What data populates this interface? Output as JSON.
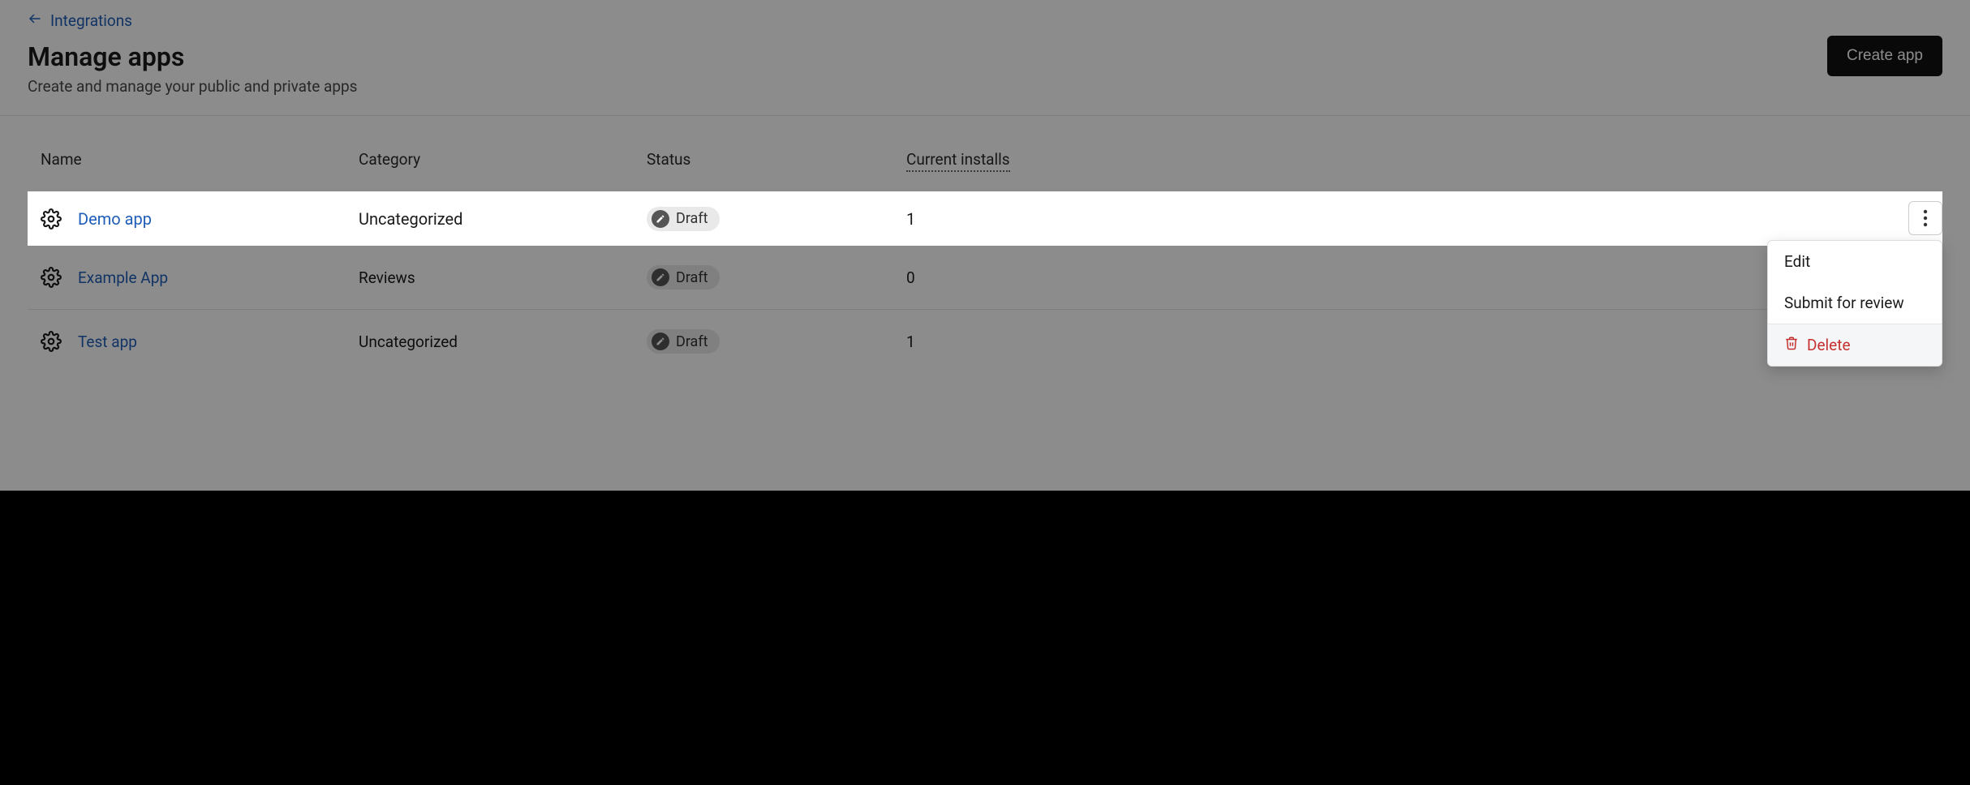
{
  "breadcrumb": {
    "label": "Integrations"
  },
  "header": {
    "title": "Manage apps",
    "subtitle": "Create and manage your public and private apps",
    "create_label": "Create app"
  },
  "table": {
    "columns": {
      "name": "Name",
      "category": "Category",
      "status": "Status",
      "installs": "Current installs"
    },
    "rows": [
      {
        "name": "Demo app",
        "category": "Uncategorized",
        "status": "Draft",
        "installs": "1"
      },
      {
        "name": "Example App",
        "category": "Reviews",
        "status": "Draft",
        "installs": "0"
      },
      {
        "name": "Test app",
        "category": "Uncategorized",
        "status": "Draft",
        "installs": "1"
      }
    ]
  },
  "menu": {
    "edit": "Edit",
    "submit": "Submit for review",
    "delete": "Delete"
  }
}
